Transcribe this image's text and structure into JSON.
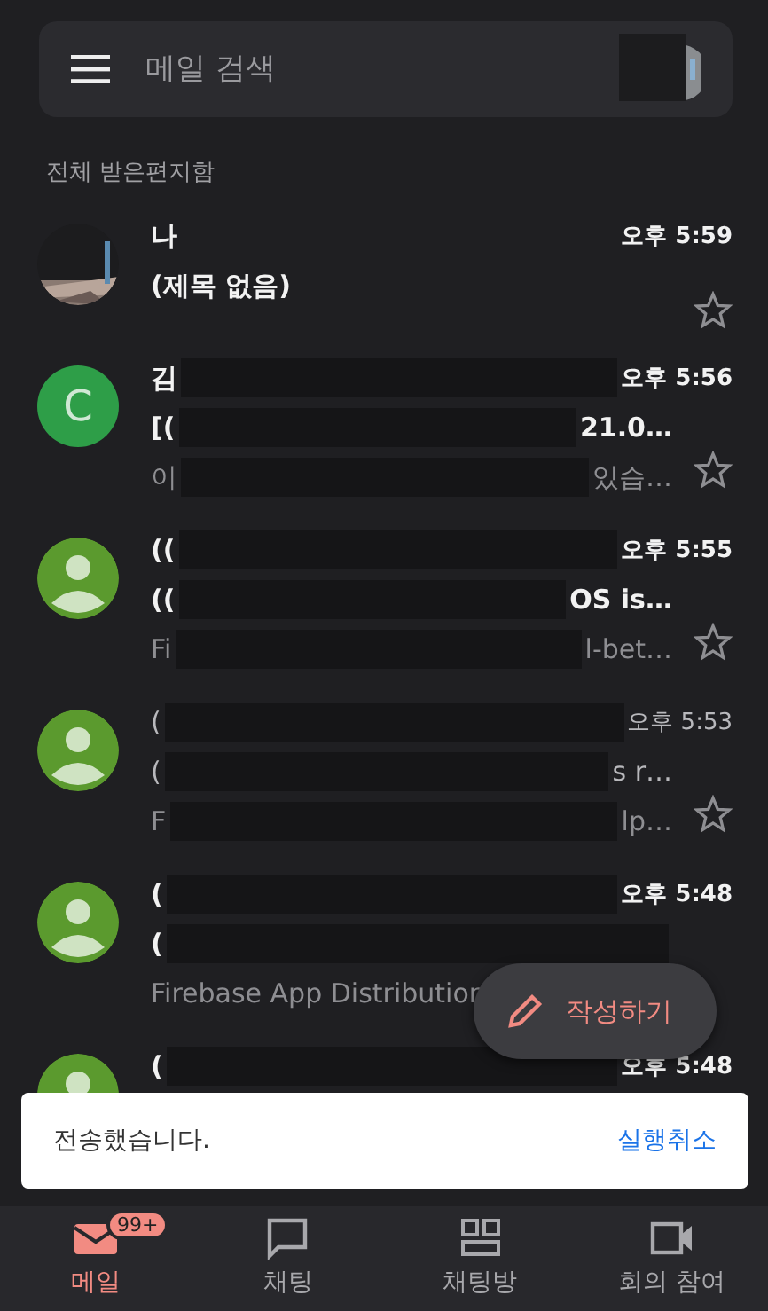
{
  "search": {
    "placeholder": "메일 검색"
  },
  "section_label": "전체 받은편지함",
  "messages": [
    {
      "unread": true,
      "starred": false,
      "time": "오후 5:59",
      "sender": {
        "start": "나"
      },
      "subject": {
        "start": "(제목 없음)"
      }
    },
    {
      "avatar": {
        "kind": "letter",
        "letter": "C",
        "color": "#2e9e48"
      },
      "unread": true,
      "starred": false,
      "time": "오후 5:56",
      "sender": {
        "start": "김",
        "redacted": true
      },
      "subject": {
        "start": "[(",
        "redacted": true,
        "end": "21.0…"
      },
      "preview": {
        "start": "이",
        "redacted": true,
        "end": "있습…"
      }
    },
    {
      "avatar": {
        "kind": "person",
        "color": "#5b9a2e"
      },
      "unread": true,
      "starred": false,
      "time": "오후 5:55",
      "sender": {
        "start": "((",
        "redacted": true
      },
      "subject": {
        "start": "((",
        "redacted": true,
        "end": "OS is…"
      },
      "preview": {
        "start": "Fi",
        "redacted": true,
        "end": "l-bet…"
      }
    },
    {
      "avatar": {
        "kind": "person",
        "color": "#5b9a2e"
      },
      "unread": false,
      "starred": false,
      "time": "오후 5:53",
      "sender": {
        "start": "(",
        "redacted": true
      },
      "subject": {
        "start": "(",
        "redacted": true,
        "end": "s r…"
      },
      "preview": {
        "start": "F",
        "redacted": true,
        "end": "lp…"
      }
    },
    {
      "avatar": {
        "kind": "person",
        "color": "#5b9a2e"
      },
      "unread": true,
      "time": "오후 5:48",
      "sender": {
        "start": "(",
        "redacted": true
      },
      "subject": {
        "start": "(",
        "redacted": true
      },
      "preview": {
        "start": "Firebase App Distribution"
      }
    },
    {
      "avatar": {
        "kind": "person",
        "color": "#5b9a2e"
      },
      "unread": true,
      "time": "오후 5:48",
      "sender": {
        "start": "(",
        "redacted": true
      }
    }
  ],
  "compose_button": {
    "label": "작성하기"
  },
  "snackbar": {
    "message": "전송했습니다.",
    "action": "실행취소"
  },
  "bottom_nav": [
    {
      "kind": "mail",
      "label": "메일",
      "selected": true,
      "badge": "99+"
    },
    {
      "kind": "chat",
      "label": "채팅",
      "selected": false
    },
    {
      "kind": "rooms",
      "label": "채팅방",
      "selected": false
    },
    {
      "kind": "meet",
      "label": "회의 참여",
      "selected": false
    }
  ]
}
